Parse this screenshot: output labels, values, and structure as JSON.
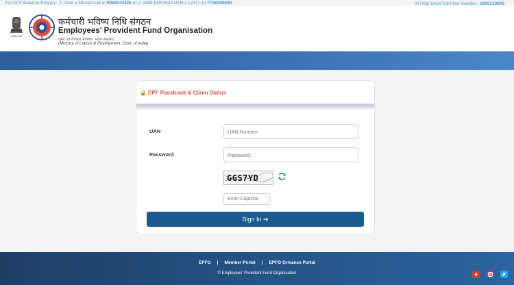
{
  "topbar": {
    "enquiry_prefix": "For EPF Balance Enquiry : 1. Give a Missed call to ",
    "missed_call_number": "9966044425",
    "enquiry_middle": " or 2. SMS EPFOHO UAN < LAN > to ",
    "sms_number": "7738299899",
    "helpdesk_label": "Help Desk/Toll Free Number : ",
    "helpdesk_number": "1800118005"
  },
  "header": {
    "emblem_caption": "सत्यमेव जयते",
    "org_name_hindi": "कर्मचारी भविष्य निधि संगठन",
    "org_name_english": "Employees' Provident Fund Organisation",
    "org_sub_hindi": "(श्रम एवं रोजगार मंत्रालय, भारत सरकार)",
    "org_sub_english": "(Ministry of Labour & Employment, Govt. of India)"
  },
  "login": {
    "title": "EPF Passbook & Claim Status",
    "uan_label": "UAN",
    "uan_placeholder": "UAN Number",
    "password_label": "Password",
    "password_placeholder": "Password",
    "captcha_text": "GGS7YD",
    "captcha_placeholder": "Enter Captcha",
    "signin_label": "Sign In"
  },
  "footer": {
    "links": [
      "EPFO",
      "Member Portal",
      "EPFO Grivance Portal"
    ],
    "separator": "|",
    "copyright": "© Employees' Provident Fund Organisation"
  },
  "colors": {
    "accent_blue": "#1c5a90",
    "title_red": "#d9534f",
    "topbar_text": "#3aa0d8"
  },
  "icons": [
    "lock-icon",
    "refresh-icon",
    "signin-arrow-icon",
    "youtube-icon",
    "instagram-icon",
    "twitter-icon"
  ]
}
